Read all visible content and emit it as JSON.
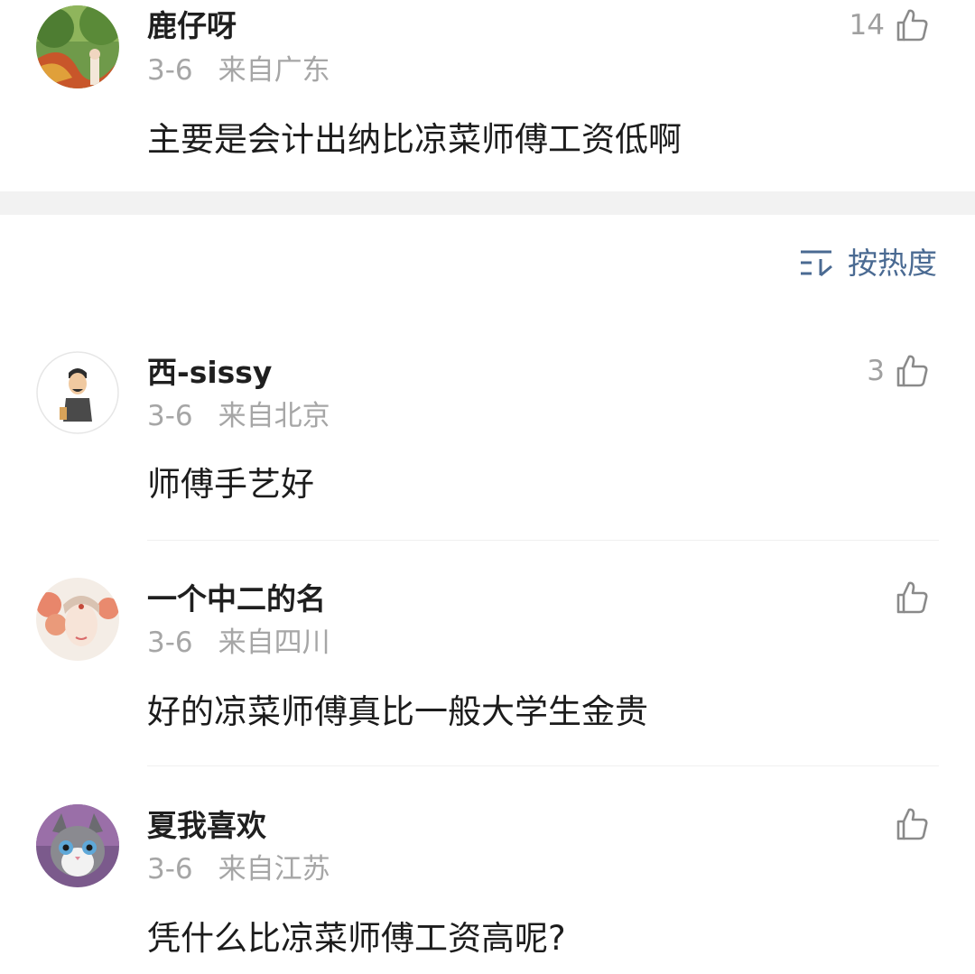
{
  "comments": [
    {
      "username": "鹿仔呀",
      "date": "3-6",
      "location": "来自广东",
      "text": "主要是会计出纳比凉菜师傅工资低啊",
      "likes": "14",
      "avatar_icon": "forest-avatar-icon"
    },
    {
      "username": "西-sissy",
      "date": "3-6",
      "location": "来自北京",
      "text": "师傅手艺好",
      "likes": "3",
      "avatar_icon": "cartoon-man-avatar-icon"
    },
    {
      "username": "一个中二的名",
      "date": "3-6",
      "location": "来自四川",
      "text": "好的凉菜师傅真比一般大学生金贵",
      "likes": "",
      "avatar_icon": "illustrated-girl-avatar-icon"
    },
    {
      "username": "夏我喜欢",
      "date": "3-6",
      "location": "来自江苏",
      "text": "凭什么比凉菜师傅工资高呢?",
      "likes": "",
      "avatar_icon": "cat-avatar-icon"
    }
  ],
  "sort": {
    "label": "按热度",
    "icon": "sort-icon"
  },
  "colors": {
    "username": "#1f1f1f",
    "meta": "#a6a6a6",
    "sort_accent": "#4a6a92",
    "section_gap": "#f2f2f2"
  }
}
